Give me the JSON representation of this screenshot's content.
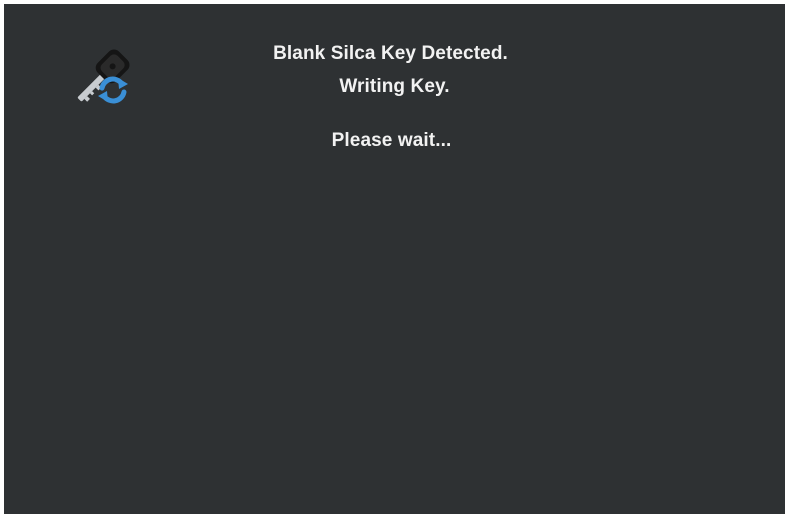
{
  "dialog": {
    "icon": "key-sync-icon",
    "lines": [
      "Blank Silca Key Detected.",
      "Writing Key.",
      "Please wait..."
    ]
  },
  "colors": {
    "background": "#2e3133",
    "text": "#f2f2f2",
    "key": "#1a1a1a",
    "key_blade": "#c8ccd0",
    "sync_arrows": "#3a8fd6"
  }
}
